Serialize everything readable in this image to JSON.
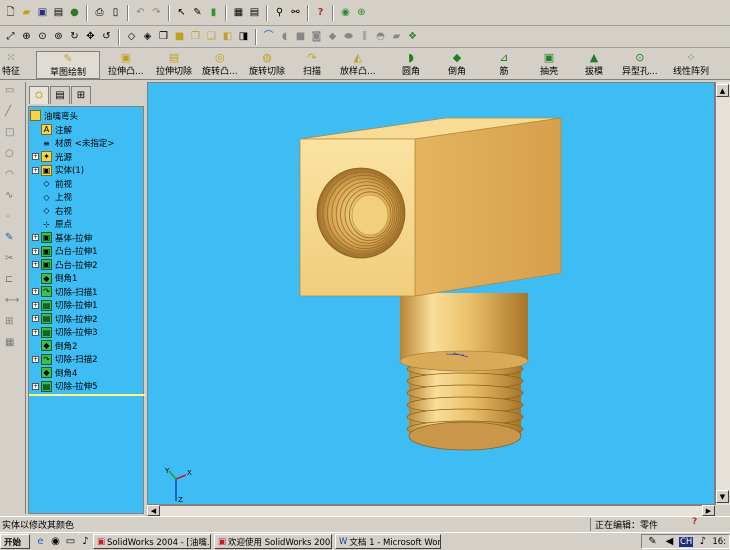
{
  "toolbar_top": {
    "icons": [
      "new-file-icon",
      "open-folder-icon",
      "save-icon",
      "sheet-icon",
      "globe-icon",
      "print-icon",
      "print-preview-icon",
      "cut-icon",
      "undo-icon",
      "redo-icon",
      "select-arrow-icon",
      "sketch-pencil-icon",
      "rebuild-icon",
      "grid-icon",
      "table-icon",
      "filter-icon",
      "zoom-select-icon",
      "help-icon",
      "eye-icon",
      "target-icon"
    ]
  },
  "toolbar_view": {
    "icons": [
      "zoom-fit-icon",
      "zoom-area-icon",
      "zoom-in-icon",
      "pan-icon",
      "rotate-icon",
      "wireframe-icon",
      "hidden-lines-icon",
      "shaded-icon",
      "cube-view-icon",
      "cube-front-icon",
      "cube-top-icon",
      "perspective-icon",
      "section-icon",
      "render-icon",
      "curve-icon",
      "fillet-tool-icon",
      "chamfer-tool-icon",
      "shell-tool-icon",
      "draft-tool-icon",
      "mirror-tool-icon",
      "pattern-tool-icon",
      "dome-tool-icon",
      "scale-tool-icon"
    ]
  },
  "features_bar": {
    "tab_feature": "特征",
    "sketch_draw": "草图绘制",
    "buttons": [
      "拉伸凸...",
      "拉伸切除",
      "旋转凸...",
      "旋转切除",
      "扫描",
      "放样凸...",
      "圆角",
      "倒角",
      "筋",
      "抽壳",
      "拔模",
      "异型孔...",
      "线性阵列"
    ]
  },
  "tree": {
    "root": "油嘴弯头",
    "items": [
      {
        "label": "注解",
        "icon": "annotation-icon",
        "expand": false
      },
      {
        "label": "材质 <未指定>",
        "icon": "material-icon",
        "expand": false
      },
      {
        "label": "光源",
        "icon": "light-icon",
        "expand": true
      },
      {
        "label": "实体(1)",
        "icon": "solid-body-icon",
        "expand": true
      },
      {
        "label": "前视",
        "icon": "plane-icon",
        "expand": false
      },
      {
        "label": "上视",
        "icon": "plane-icon",
        "expand": false
      },
      {
        "label": "右视",
        "icon": "plane-icon",
        "expand": false
      },
      {
        "label": "原点",
        "icon": "origin-icon",
        "expand": false
      },
      {
        "label": "基体-拉伸",
        "icon": "extrude-icon",
        "expand": true
      },
      {
        "label": "凸台-拉伸1",
        "icon": "extrude-icon",
        "expand": true
      },
      {
        "label": "凸台-拉伸2",
        "icon": "extrude-icon",
        "expand": true
      },
      {
        "label": "倒角1",
        "icon": "chamfer-icon",
        "expand": false
      },
      {
        "label": "切除-扫描1",
        "icon": "cut-sweep-icon",
        "expand": true
      },
      {
        "label": "切除-拉伸1",
        "icon": "cut-extrude-icon",
        "expand": true
      },
      {
        "label": "切除-拉伸2",
        "icon": "cut-extrude-icon",
        "expand": true
      },
      {
        "label": "切除-拉伸3",
        "icon": "cut-extrude-icon",
        "expand": true
      },
      {
        "label": "倒角2",
        "icon": "chamfer-icon",
        "expand": false
      },
      {
        "label": "切除-扫描2",
        "icon": "cut-sweep-icon",
        "expand": true
      },
      {
        "label": "倒角4",
        "icon": "chamfer-icon",
        "expand": false
      },
      {
        "label": "切除-拉伸5",
        "icon": "cut-extrude-icon",
        "expand": true
      }
    ]
  },
  "viewport": {
    "background": "#3dbdf4",
    "triad_x": "X",
    "triad_y": "Y",
    "triad_z": "Z"
  },
  "status": {
    "left": "实体以修改其颜色",
    "editing": "正在编辑：零件"
  },
  "taskbar": {
    "start": "开始",
    "tasks": [
      "SolidWorks 2004 - [油嘴...",
      "欢迎使用 SolidWorks 2004",
      "文档 1 - Microsoft Word"
    ],
    "tray_lang": "CH",
    "clock": "16:"
  },
  "colors": {
    "brass_light": "#f6d78a",
    "brass_mid": "#e3b35a",
    "brass_dark": "#b98434",
    "tree_bg": "#3dbdf4"
  }
}
